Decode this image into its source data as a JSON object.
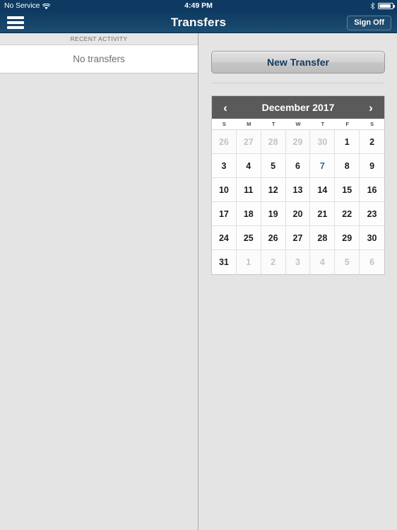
{
  "status_bar": {
    "carrier": "No Service",
    "wifi_icon": "wifi-icon",
    "time": "4:49 PM",
    "bluetooth_icon": "bluetooth-icon",
    "battery_icon": "battery-icon"
  },
  "nav_bar": {
    "menu_icon": "hamburger-menu-icon",
    "title": "Transfers",
    "sign_off_label": "Sign Off"
  },
  "left_panel": {
    "section_header": "RECENT ACTIVITY",
    "empty_message": "No transfers"
  },
  "right_panel": {
    "new_transfer_label": "New Transfer"
  },
  "calendar": {
    "prev_icon": "‹",
    "next_icon": "›",
    "title": "December 2017",
    "weekdays": [
      "S",
      "M",
      "T",
      "W",
      "T",
      "F",
      "S"
    ],
    "today": 7,
    "weeks": [
      [
        {
          "n": "26",
          "muted": true
        },
        {
          "n": "27",
          "muted": true
        },
        {
          "n": "28",
          "muted": true
        },
        {
          "n": "29",
          "muted": true
        },
        {
          "n": "30",
          "muted": true
        },
        {
          "n": "1",
          "muted": false
        },
        {
          "n": "2",
          "muted": false
        }
      ],
      [
        {
          "n": "3",
          "muted": false
        },
        {
          "n": "4",
          "muted": false
        },
        {
          "n": "5",
          "muted": false
        },
        {
          "n": "6",
          "muted": false
        },
        {
          "n": "7",
          "muted": false,
          "today": true
        },
        {
          "n": "8",
          "muted": false
        },
        {
          "n": "9",
          "muted": false
        }
      ],
      [
        {
          "n": "10",
          "muted": false
        },
        {
          "n": "11",
          "muted": false
        },
        {
          "n": "12",
          "muted": false
        },
        {
          "n": "13",
          "muted": false
        },
        {
          "n": "14",
          "muted": false
        },
        {
          "n": "15",
          "muted": false
        },
        {
          "n": "16",
          "muted": false
        }
      ],
      [
        {
          "n": "17",
          "muted": false
        },
        {
          "n": "18",
          "muted": false
        },
        {
          "n": "19",
          "muted": false
        },
        {
          "n": "20",
          "muted": false
        },
        {
          "n": "21",
          "muted": false
        },
        {
          "n": "22",
          "muted": false
        },
        {
          "n": "23",
          "muted": false
        }
      ],
      [
        {
          "n": "24",
          "muted": false
        },
        {
          "n": "25",
          "muted": false
        },
        {
          "n": "26",
          "muted": false
        },
        {
          "n": "27",
          "muted": false
        },
        {
          "n": "28",
          "muted": false
        },
        {
          "n": "29",
          "muted": false
        },
        {
          "n": "30",
          "muted": false
        }
      ],
      [
        {
          "n": "31",
          "muted": false
        },
        {
          "n": "1",
          "muted": true
        },
        {
          "n": "2",
          "muted": true
        },
        {
          "n": "3",
          "muted": true
        },
        {
          "n": "4",
          "muted": true
        },
        {
          "n": "5",
          "muted": true
        },
        {
          "n": "6",
          "muted": true
        }
      ]
    ]
  },
  "colors": {
    "nav_blue_top": "#0d3a61",
    "nav_blue_bottom": "#1b4c73",
    "status_bar": "#0e3a62",
    "page_background": "#e4e4e4",
    "calendar_header": "#5a5a5a",
    "today_accent": "#2e6a9e",
    "button_text": "#123a5e"
  }
}
